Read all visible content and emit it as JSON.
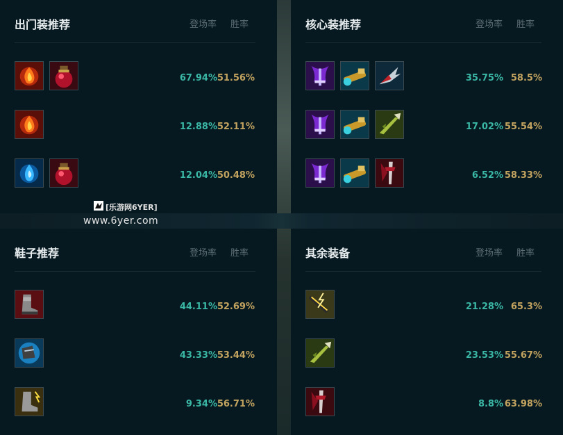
{
  "sections": [
    {
      "title": "出门装推荐",
      "col_pick": "登场率",
      "col_win": "胜率",
      "rows": [
        {
          "items": [
            "doran-ring-icon",
            "refillable-potion-icon"
          ],
          "pick": "67.94%",
          "win": "51.56%"
        },
        {
          "items": [
            "doran-ring-icon"
          ],
          "pick": "12.88%",
          "win": "52.11%"
        },
        {
          "items": [
            "dark-seal-icon",
            "refillable-potion-icon"
          ],
          "pick": "12.04%",
          "win": "50.48%"
        }
      ]
    },
    {
      "title": "核心装推荐",
      "col_pick": "登场率",
      "col_win": "胜率",
      "rows": [
        {
          "items": [
            "purple-sword-icon",
            "cannon-icon",
            "winged-blade-icon"
          ],
          "pick": "35.75%",
          "win": "58.5%"
        },
        {
          "items": [
            "purple-sword-icon",
            "cannon-icon",
            "green-spear-icon"
          ],
          "pick": "17.02%",
          "win": "55.54%"
        },
        {
          "items": [
            "purple-sword-icon",
            "cannon-icon",
            "red-blade-icon"
          ],
          "pick": "6.52%",
          "win": "58.33%"
        }
      ]
    },
    {
      "title": "鞋子推荐",
      "col_pick": "登场率",
      "col_win": "胜率",
      "rows": [
        {
          "items": [
            "armored-boots-icon"
          ],
          "pick": "44.11%",
          "win": "52.69%"
        },
        {
          "items": [
            "mercury-boots-icon"
          ],
          "pick": "43.33%",
          "win": "53.44%"
        },
        {
          "items": [
            "swift-boots-icon"
          ],
          "pick": "9.34%",
          "win": "56.71%"
        }
      ]
    },
    {
      "title": "其余装备",
      "col_pick": "登场率",
      "col_win": "胜率",
      "rows": [
        {
          "items": [
            "lightning-blade-icon"
          ],
          "pick": "21.28%",
          "win": "65.3%"
        },
        {
          "items": [
            "green-spear-icon"
          ],
          "pick": "23.53%",
          "win": "55.67%"
        },
        {
          "items": [
            "red-blade-icon"
          ],
          "pick": "8.8%",
          "win": "63.98%"
        }
      ]
    }
  ],
  "watermark": {
    "logo_text": "[乐游网6YER]",
    "url": "www.6yer.com"
  },
  "colors": {
    "pick": "#3ab7a5",
    "win": "#c2a35f",
    "panel_bg": "#071920"
  }
}
